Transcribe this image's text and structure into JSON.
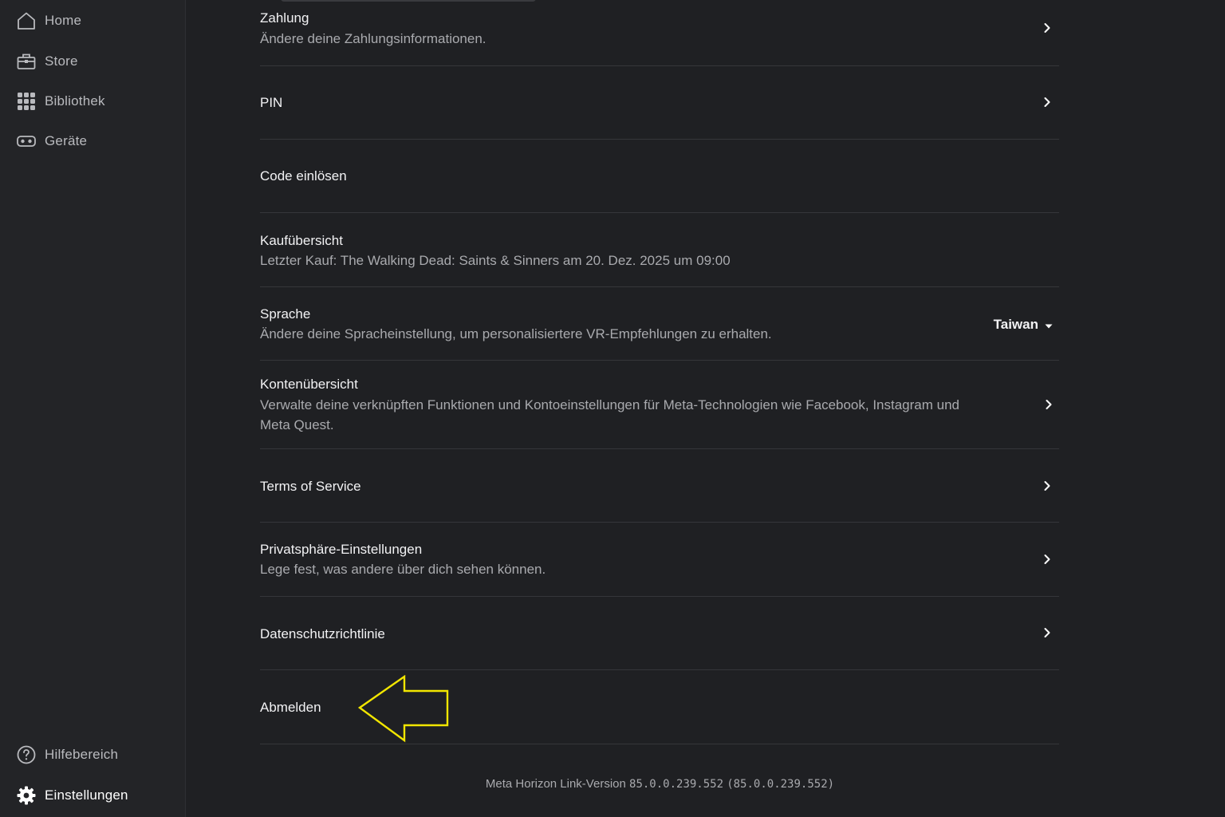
{
  "sidebar": {
    "items": [
      {
        "label": "Home",
        "icon": "home-icon"
      },
      {
        "label": "Store",
        "icon": "store-icon"
      },
      {
        "label": "Bibliothek",
        "icon": "grid-icon"
      },
      {
        "label": "Geräte",
        "icon": "headset-icon"
      }
    ],
    "bottom_items": [
      {
        "label": "Hilfebereich",
        "icon": "help-icon"
      },
      {
        "label": "Einstellungen",
        "icon": "gear-icon"
      }
    ]
  },
  "settings": {
    "zahlung": {
      "title": "Zahlung",
      "subtitle": "Ändere deine Zahlungsinformationen."
    },
    "pin": {
      "title": "PIN"
    },
    "code": {
      "title": "Code einlösen"
    },
    "kauf": {
      "title": "Kaufübersicht",
      "subtitle": "Letzter Kauf: The Walking Dead: Saints & Sinners am 20. Dez. 2025 um 09:00"
    },
    "sprache": {
      "title": "Sprache",
      "subtitle": "Ändere deine Spracheinstellung, um personalisiertere VR-Empfehlungen zu erhalten.",
      "value": "Taiwan"
    },
    "konten": {
      "title": "Kontenübersicht",
      "subtitle_line1": "Verwalte deine verknüpften Funktionen und Kontoeinstellungen für Meta-Technologien wie Facebook, Instagram und",
      "subtitle_line2": "Meta Quest."
    },
    "tos": {
      "title": "Terms of Service"
    },
    "privat": {
      "title": "Privatsphäre-Einstellungen",
      "subtitle": "Lege fest, was andere über dich sehen können."
    },
    "datenschutz": {
      "title": "Datenschutzrichtlinie"
    },
    "abmelden": {
      "title": "Abmelden"
    }
  },
  "footer": {
    "version_prefix": "Meta Horizon Link-Version",
    "version_number": "85.0.0.239.552",
    "version_paren": "(85.0.0.239.552)"
  },
  "colors": {
    "background": "#1f2023",
    "sidebar": "#232427",
    "annotation_arrow": "#f2e600"
  }
}
